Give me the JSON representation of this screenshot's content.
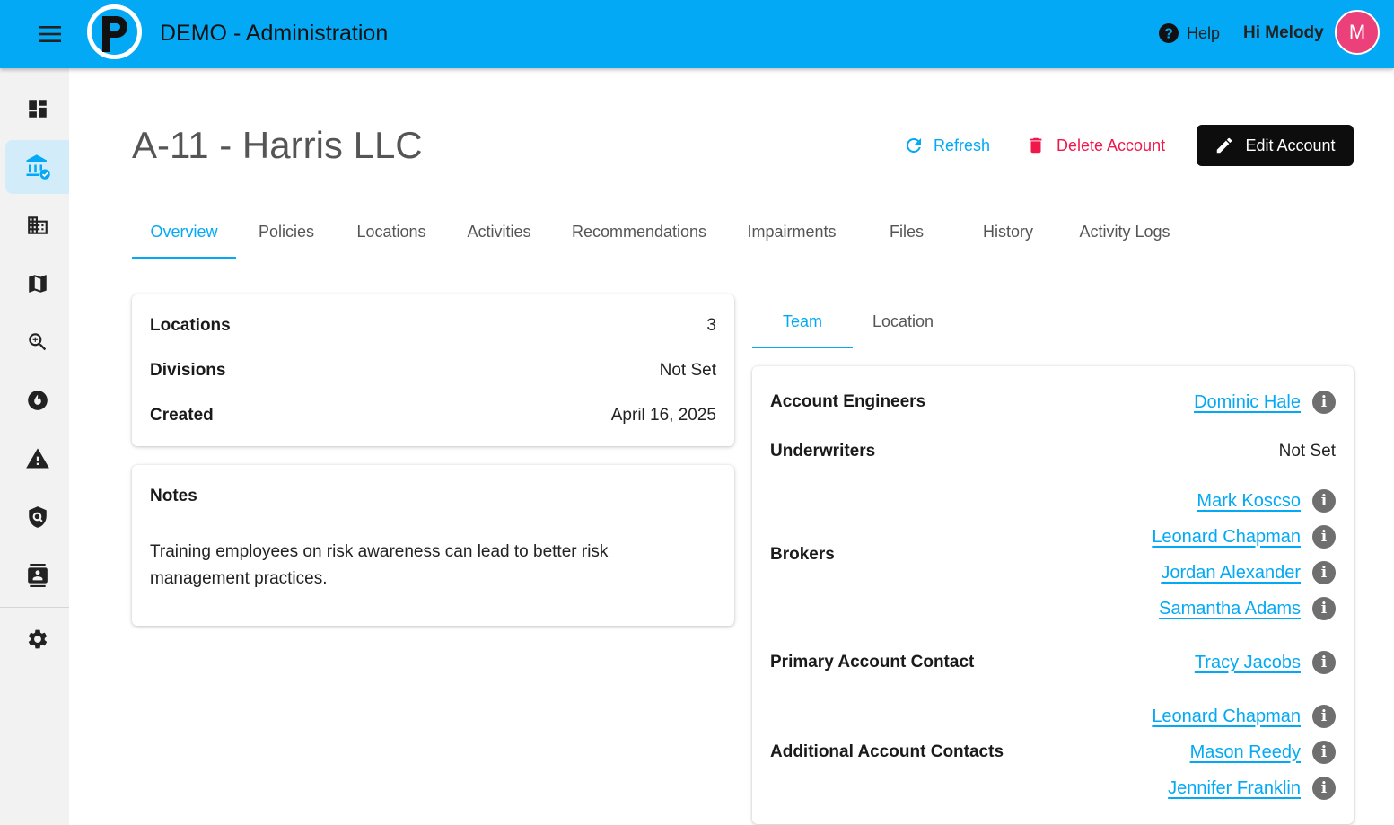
{
  "header": {
    "app_title": "DEMO - Administration",
    "help_label": "Help",
    "greeting": "Hi Melody",
    "avatar_initial": "M",
    "accent_color": "#03a9f4",
    "avatar_color": "#ec407a"
  },
  "sidebar": {
    "items": [
      {
        "icon": "dashboard-icon"
      },
      {
        "icon": "accounts-bank-icon",
        "active": true
      },
      {
        "icon": "buildings-icon"
      },
      {
        "icon": "map-icon"
      },
      {
        "icon": "search-zoom-icon"
      },
      {
        "icon": "fire-icon"
      },
      {
        "icon": "warning-icon"
      },
      {
        "icon": "shield-search-icon"
      },
      {
        "icon": "contacts-icon"
      },
      {
        "icon": "settings-gear-icon"
      }
    ]
  },
  "page": {
    "title": "A-11 - Harris LLC",
    "actions": {
      "refresh": "Refresh",
      "delete": "Delete Account",
      "edit": "Edit Account"
    },
    "tabs": [
      "Overview",
      "Policies",
      "Locations",
      "Activities",
      "Recommendations",
      "Impairments",
      "Files",
      "History",
      "Activity Logs"
    ],
    "active_tab": "Overview"
  },
  "summary": {
    "rows": [
      {
        "label": "Locations",
        "value": "3"
      },
      {
        "label": "Divisions",
        "value": "Not Set"
      },
      {
        "label": "Created",
        "value": "April 16, 2025"
      }
    ]
  },
  "notes": {
    "title": "Notes",
    "text": "Training employees on risk awareness can lead to better risk management practices."
  },
  "team_panel": {
    "tabs": [
      "Team",
      "Location"
    ],
    "active_tab": "Team",
    "account_engineers": {
      "label": "Account Engineers",
      "people": [
        "Dominic Hale"
      ]
    },
    "underwriters": {
      "label": "Underwriters",
      "value": "Not Set"
    },
    "brokers": {
      "label": "Brokers",
      "people": [
        "Mark Koscso",
        "Leonard Chapman",
        "Jordan Alexander",
        "Samantha Adams"
      ]
    },
    "primary_contact": {
      "label": "Primary Account Contact",
      "people": [
        "Tracy Jacobs"
      ]
    },
    "additional_contacts": {
      "label": "Additional Account Contacts",
      "people": [
        "Leonard Chapman",
        "Mason Reedy",
        "Jennifer Franklin"
      ]
    }
  }
}
